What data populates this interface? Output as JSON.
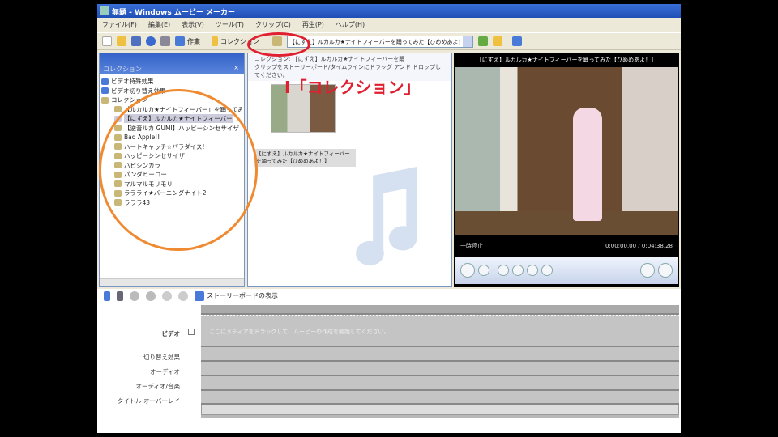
{
  "window": {
    "title": "無題 - Windows ムービー メーカー"
  },
  "menu": [
    "ファイル(F)",
    "編集(E)",
    "表示(V)",
    "ツール(T)",
    "クリップ(C)",
    "再生(P)",
    "ヘルプ(H)"
  ],
  "toolbar": {
    "tasks": "作業",
    "collections": "コレクション",
    "combo": "【にずえ】ルカルカ★ナイトフィーバーを踊ってみた【ひめめあよ！】"
  },
  "collections_pane": {
    "title": "コレクション",
    "close": "×",
    "items": [
      {
        "label": "ビデオ特殊効果",
        "level": 1
      },
      {
        "label": "ビデオ切り替え効果",
        "level": 1
      },
      {
        "label": "コレクション",
        "level": 1
      },
      {
        "label": "【ルカルカ★ナイトフィーバー」を踊ってみた",
        "level": 2
      },
      {
        "label": "【にずえ】ルカルカ★ナイトフィーバー",
        "level": 2,
        "selected": true
      },
      {
        "label": "【逆音ルカ GUMI】ハッピーシンセサイザ",
        "level": 2
      },
      {
        "label": "Bad Apple!!",
        "level": 2
      },
      {
        "label": "ハートキャッチ☆パラダイス!",
        "level": 2
      },
      {
        "label": "ハッピーシンセサイザ",
        "level": 2
      },
      {
        "label": "ハピシンカラ",
        "level": 2
      },
      {
        "label": "パンダヒーロー",
        "level": 2
      },
      {
        "label": "マルマルモリモリ",
        "level": 2
      },
      {
        "label": "ララライ★バーニングナイト2",
        "level": 2
      },
      {
        "label": "ラララ43",
        "level": 2
      }
    ]
  },
  "content": {
    "header1": "コレクション: 【にずえ】ルカルカ★ナイトフィーバーを踊",
    "header2": "クリップをストーリーボード/タイムラインにドラッグ アンド ドロップしてください。",
    "clip_caption": "【にずえ】ルカルカ★ナイトフィーバーを踊ってみた【ひめめあよ！】",
    "annotation": "I「コレクション」"
  },
  "preview": {
    "title": "【にずえ】ルカルカ★ナイトフィーバーを踊ってみた【ひめめあよ！】",
    "status": "一時停止",
    "time": "0:00:00.00 / 0:04:38.28"
  },
  "timeline": {
    "storyboard_toggle": "ストーリーボードの表示",
    "tracks": [
      "ビデオ",
      "切り替え効果",
      "オーディオ",
      "オーディオ/音楽",
      "タイトル オーバーレイ"
    ],
    "hint": "ここにメディアをドラッグして、ムービーの作成を開始してください。"
  },
  "colors": {
    "annotation_red": "#e02030",
    "annotation_orange": "#f08a30",
    "title_blue": "#1f4fb6"
  }
}
